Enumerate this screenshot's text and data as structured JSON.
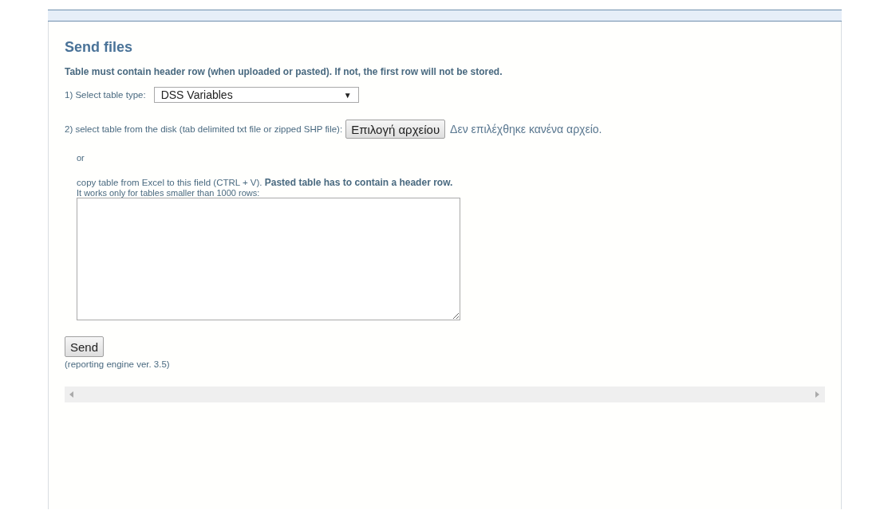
{
  "title": "Send files",
  "notice": "Table must contain header row (when uploaded or pasted). If not, the first row will not be stored.",
  "table_type": {
    "label": "1) Select table type:",
    "value": "DSS Variables",
    "arrow": "▼"
  },
  "file_select": {
    "label": "2) select table from the disk (tab delimited txt file or zipped SHP file):",
    "button": "Επιλογή αρχείου",
    "status": "Δεν επιλέχθηκε κανένα αρχείο."
  },
  "or_label": "or",
  "paste": {
    "instruction": "copy table from Excel to this field (CTRL + V). **Pasted table has to contain a header row.**",
    "limit": "It works only for tables smaller than 1000 rows:"
  },
  "send_button": "Send",
  "version": "(reporting engine ver. 3.5)"
}
